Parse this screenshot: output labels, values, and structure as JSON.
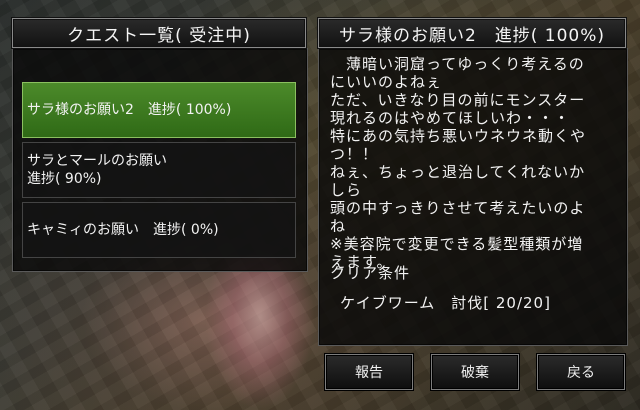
{
  "quest_list": {
    "title": "クエスト一覧( 受注中)",
    "items": [
      {
        "line1": "サラ様のお願い2　進捗( 100%)",
        "line2": ""
      },
      {
        "line1": "サラとマールのお願い",
        "line2": "進捗( 90%)"
      },
      {
        "line1": "キャミィのお願い　進捗( 0%)",
        "line2": ""
      }
    ]
  },
  "detail": {
    "title": "サラ様のお願い2　進捗( 100%)",
    "description": "　薄暗い洞窟ってゆっくり考えるの\nにいいのよねぇ\nただ、いきなり目の前にモンスター\n現れるのはやめてほしいわ・・・\n特にあの気持ち悪いウネウネ動くや\nつ！！\nねぇ、ちょっと退治してくれないか\nしら\n頭の中すっきりさせて考えたいのよ\nね\n※美容院で変更できる髪型種類が増\nえます。",
    "condition_title": "クリア条件",
    "condition_line": "ケイブワーム　討伐[ 20/20]"
  },
  "buttons": {
    "report": "報告",
    "abandon": "破棄",
    "back": "戻る"
  },
  "colors": {
    "selected_item": "#3f7d22",
    "panel_bg": "#0a0a0a",
    "border": "#8a8a8a"
  }
}
